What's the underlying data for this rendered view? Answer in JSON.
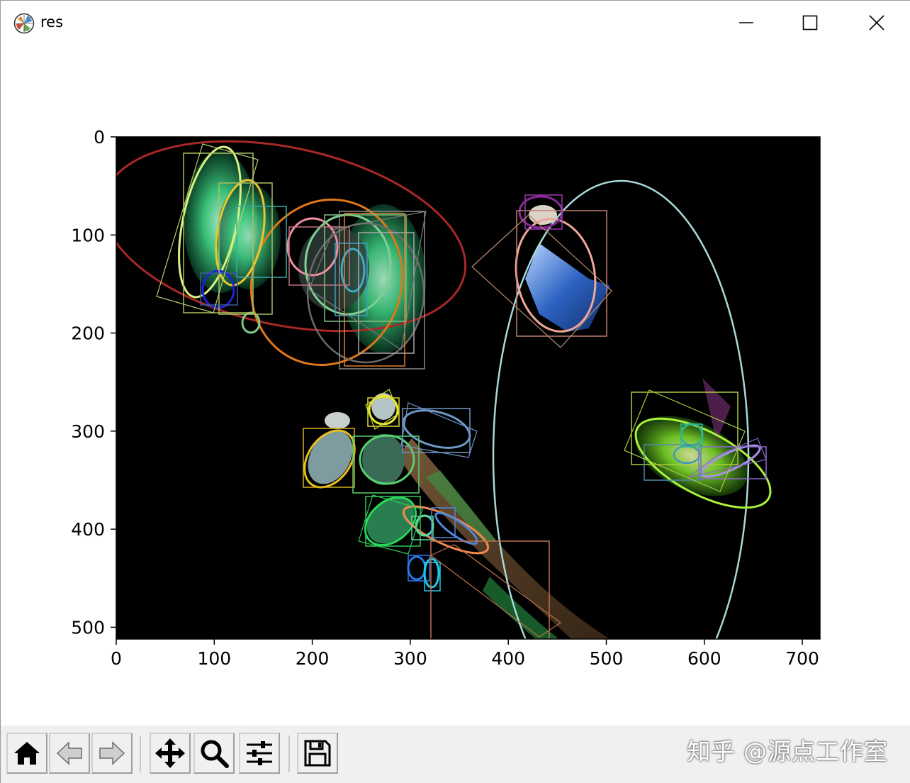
{
  "window": {
    "title": "res"
  },
  "plot": {
    "x_ticks": [
      "0",
      "100",
      "200",
      "300",
      "400",
      "500",
      "600",
      "700"
    ],
    "y_ticks": [
      "0",
      "100",
      "200",
      "300",
      "400",
      "500"
    ],
    "x_range": [
      0,
      718
    ],
    "y_range": [
      0,
      512
    ],
    "y_inverted": true,
    "image_background": "#000000"
  },
  "toolbar": {
    "buttons": [
      "home",
      "back",
      "forward",
      "pan",
      "zoom",
      "configure-subplots",
      "save"
    ]
  },
  "watermark": {
    "text": "知乎 @源点工作室"
  }
}
